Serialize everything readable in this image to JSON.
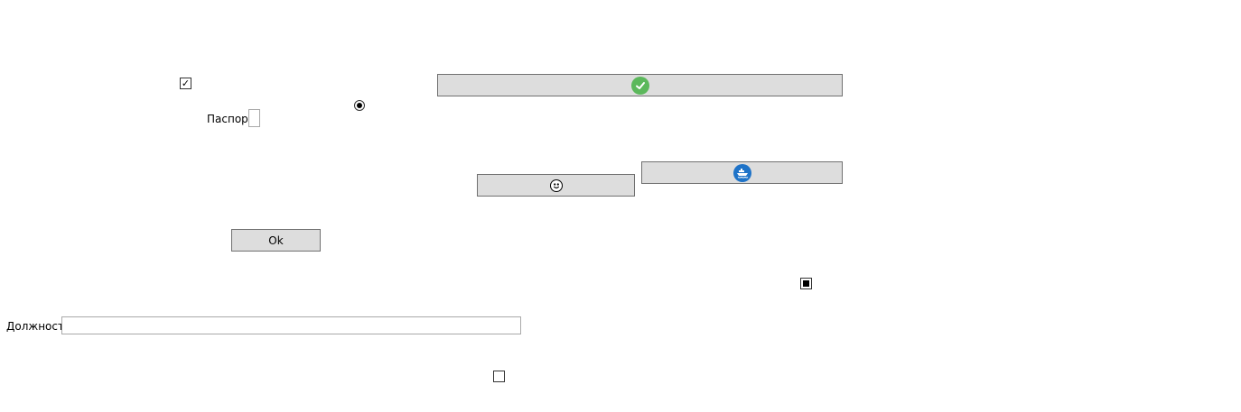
{
  "form": {
    "passport_label": "Паспорт",
    "passport_value": "",
    "position_label": "Должность",
    "position_value": "",
    "ok_button_label": "Ok"
  },
  "controls": {
    "checkbox_top_checked": true,
    "radio_checked": true,
    "checkbox_right_state": "indeterminate",
    "checkbox_bottom_checked": false
  },
  "icons": {
    "confirm_button_icon": "check-circle-icon",
    "confirm_icon_color": "#5cb85c",
    "face_button_icon": "smiley-face-icon",
    "ship_button_icon": "ship-refresh-icon",
    "ship_icon_color": "#1e73c8"
  }
}
